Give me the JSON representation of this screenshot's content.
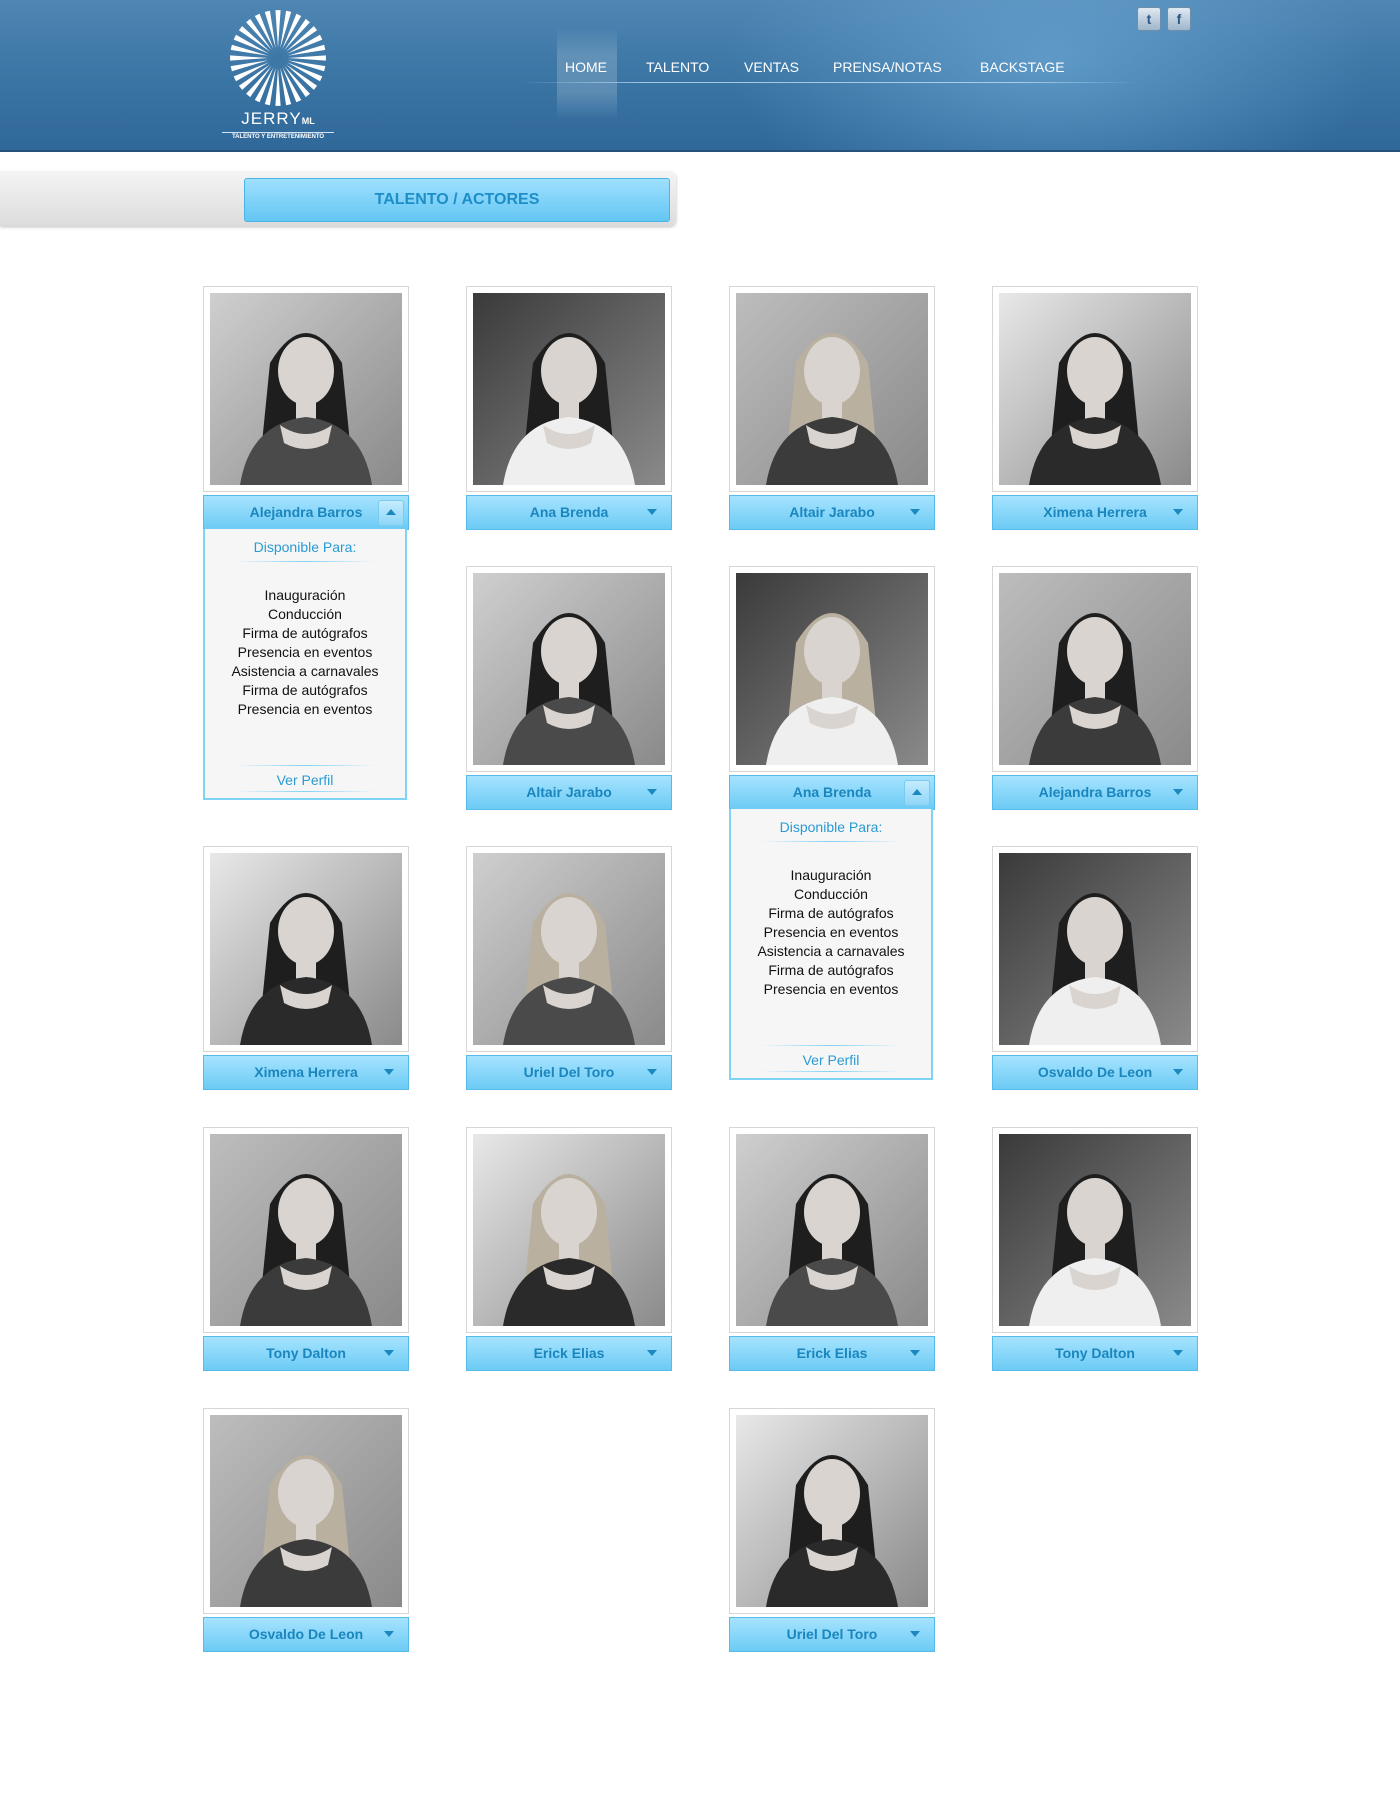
{
  "brand": {
    "name": "JERRY",
    "name_suffix": "ML",
    "tagline": "TALENTO Y ENTRETENIMIENTO"
  },
  "nav": {
    "items": [
      {
        "label": "HOME"
      },
      {
        "label": "TALENTO"
      },
      {
        "label": "VENTAS"
      },
      {
        "label": "PRENSA/NOTAS"
      },
      {
        "label": "BACKSTAGE"
      }
    ],
    "active": "HOME"
  },
  "social": {
    "twitter": "t",
    "facebook": "f"
  },
  "section": {
    "title": "TALENTO / ACTORES"
  },
  "panel_labels": {
    "title": "Disponible Para:",
    "link": "Ver Perfil"
  },
  "colors": {
    "header_blue": "#3d77a6",
    "accent_cyan": "#6ccbf4",
    "name_text": "#1a86bd"
  },
  "talents": [
    {
      "name": "Alejandra Barros",
      "expanded": true,
      "services": [
        "Inauguración",
        "Conducción",
        "Firma de autógrafos",
        "Presencia en eventos",
        "Asistencia a carnavales",
        "Firma de autógrafos",
        "Presencia en eventos"
      ]
    },
    {
      "name": "Ana Brenda",
      "expanded": false
    },
    {
      "name": "Altair Jarabo",
      "expanded": false
    },
    {
      "name": "Ximena Herrera",
      "expanded": false
    },
    {
      "name": "Altair Jarabo",
      "expanded": false
    },
    {
      "name": "Ana Brenda",
      "expanded": true,
      "services": [
        "Inauguración",
        "Conducción",
        "Firma de autógrafos",
        "Presencia en eventos",
        "Asistencia a carnavales",
        "Firma de autógrafos",
        "Presencia en eventos"
      ]
    },
    {
      "name": "Alejandra Barros",
      "expanded": false
    },
    {
      "name": "Ximena Herrera",
      "expanded": false
    },
    {
      "name": "Uriel Del Toro",
      "expanded": false
    },
    {
      "name": "Osvaldo De Leon",
      "expanded": false
    },
    {
      "name": "Tony Dalton",
      "expanded": false
    },
    {
      "name": "Erick Elias",
      "expanded": false
    },
    {
      "name": "Erick Elias",
      "expanded": false
    },
    {
      "name": "Tony Dalton",
      "expanded": false
    },
    {
      "name": "Osvaldo De Leon",
      "expanded": false
    },
    {
      "name": "Uriel Del Toro",
      "expanded": false
    }
  ]
}
